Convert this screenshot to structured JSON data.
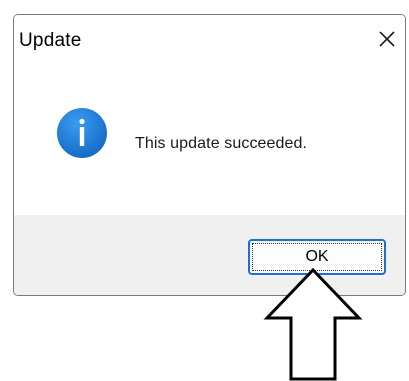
{
  "dialog": {
    "title": "Update",
    "close_icon": "close-icon",
    "icon": "info-icon",
    "message": "This update succeeded.",
    "ok_label": "OK"
  },
  "annotation": {
    "icon": "up-arrow-icon"
  },
  "colors": {
    "info_blue": "#1c7fd9",
    "focus_border": "#1d6fd6",
    "footer_bg": "#f0f0f0",
    "dialog_border": "#7a7a7a"
  }
}
